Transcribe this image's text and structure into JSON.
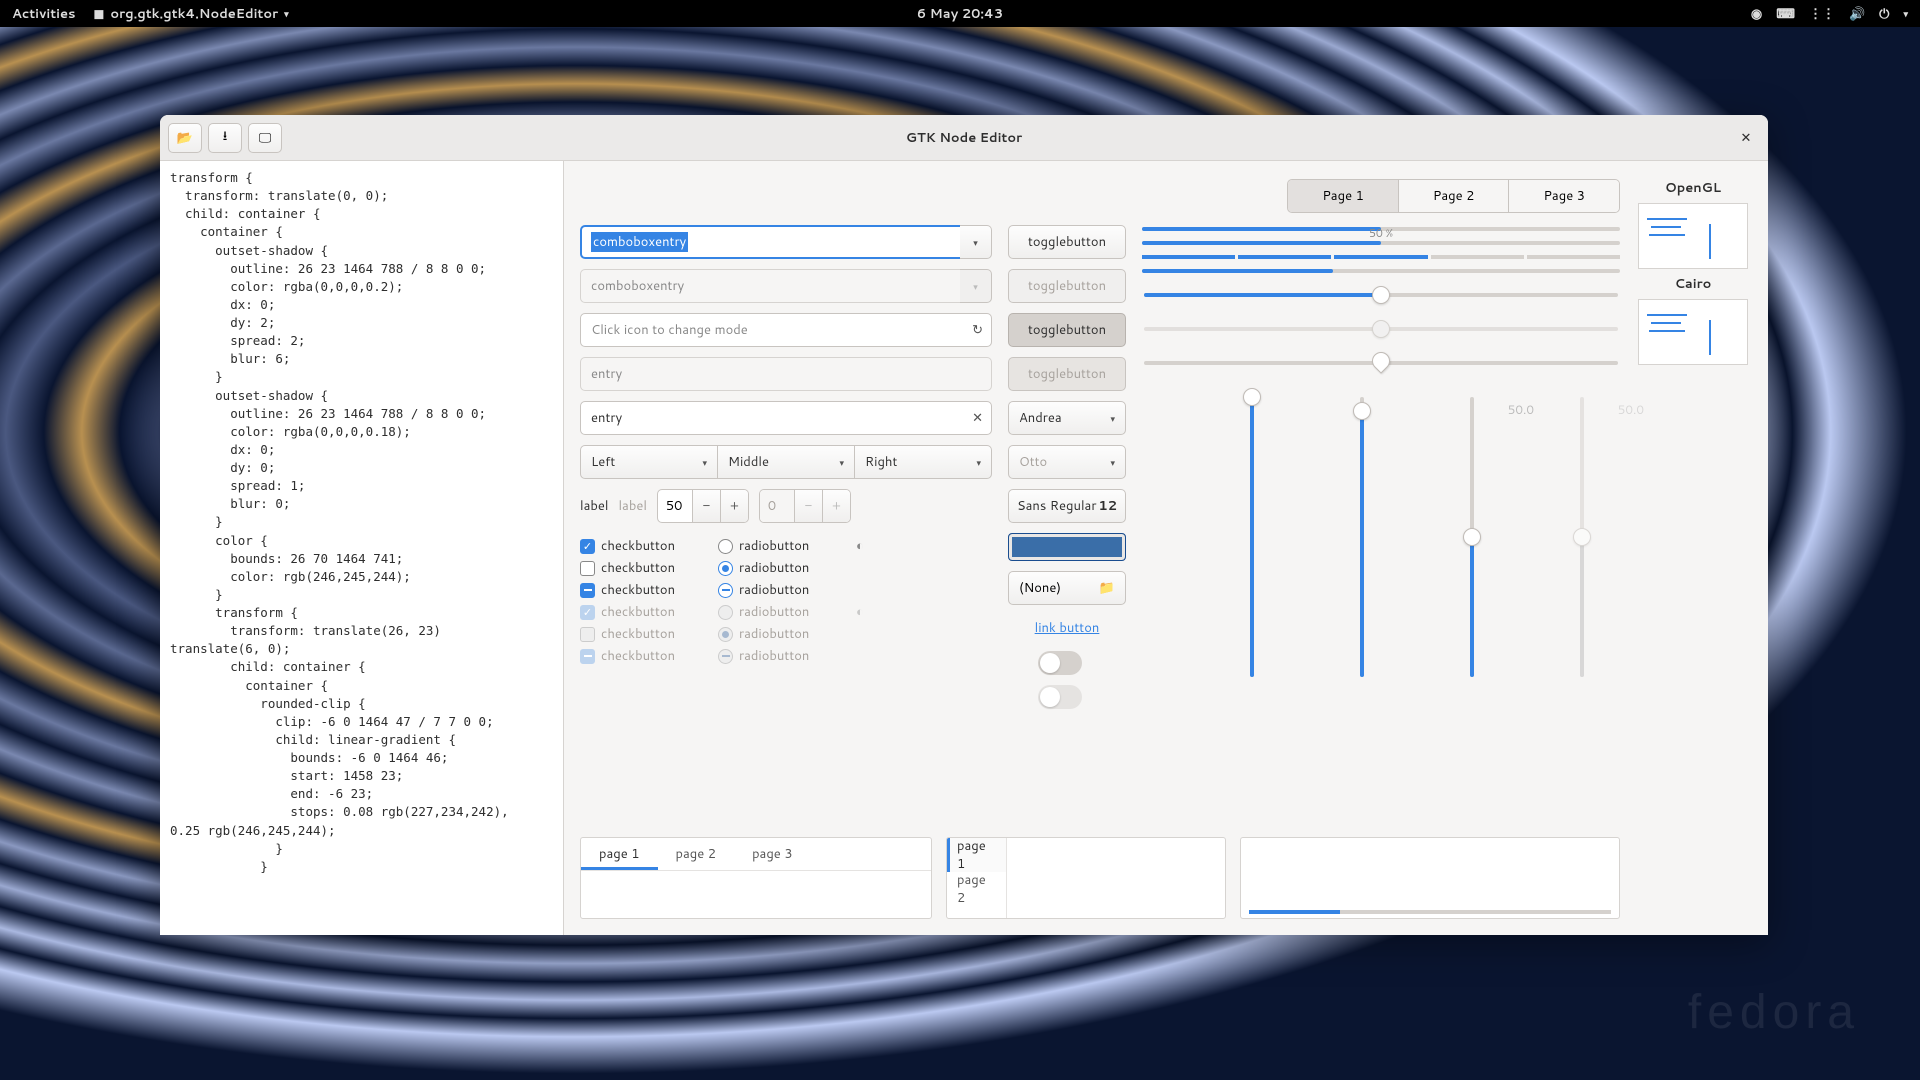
{
  "topbar": {
    "activities": "Activities",
    "app_name": "org.gtk.gtk4.NodeEditor",
    "clock": "6 May  20:43"
  },
  "window": {
    "title": "GTK Node Editor"
  },
  "code": "transform {\n  transform: translate(0, 0);\n  child: container {\n    container {\n      outset-shadow {\n        outline: 26 23 1464 788 / 8 8 0 0;\n        color: rgba(0,0,0,0.2);\n        dx: 0;\n        dy: 2;\n        spread: 2;\n        blur: 6;\n      }\n      outset-shadow {\n        outline: 26 23 1464 788 / 8 8 0 0;\n        color: rgba(0,0,0,0.18);\n        dx: 0;\n        dy: 0;\n        spread: 1;\n        blur: 0;\n      }\n      color {\n        bounds: 26 70 1464 741;\n        color: rgb(246,245,244);\n      }\n      transform {\n        transform: translate(26, 23)\ntranslate(6, 0);\n        child: container {\n          container {\n            rounded-clip {\n              clip: -6 0 1464 47 / 7 7 0 0;\n              child: linear-gradient {\n                bounds: -6 0 1464 46;\n                start: 1458 23;\n                end: -6 23;\n                stops: 0.08 rgb(227,234,242),\n0.25 rgb(246,245,244);\n              }\n            }",
  "tabs": {
    "p1": "Page 1",
    "p2": "Page 2",
    "p3": "Page 3"
  },
  "combo1": "comboboxentry",
  "combo1_placeholder": "comboboxentry",
  "combo2_placeholder": "comboboxentry",
  "icon_entry_placeholder": "Click icon to change mode",
  "entry_placeholder": "entry",
  "entry_value": "entry",
  "triple": {
    "left": "Left",
    "middle": "Middle",
    "right": "Right"
  },
  "spin": {
    "label": "label",
    "label_dis": "label",
    "v1": "50",
    "v2": "0"
  },
  "check_label": "checkbutton",
  "radio_label": "radiobutton",
  "toggle": {
    "t1": "togglebutton",
    "t2": "togglebutton",
    "t3": "togglebutton",
    "t4": "togglebutton"
  },
  "name_dd": "Andrea",
  "name_dd_dis": "Otto",
  "font_btn": "Sans Regular",
  "font_size": "12",
  "file_none": "(None)",
  "link": "link button",
  "progress_label": "50 %",
  "vlabel_a": "50.0",
  "vlabel_b": "50.0",
  "bottom_tabs": {
    "p1": "page 1",
    "p2": "page 2",
    "p3": "page 3"
  },
  "render": {
    "opengl": "OpenGL",
    "cairo": "Cairo"
  },
  "watermark": "fedora"
}
